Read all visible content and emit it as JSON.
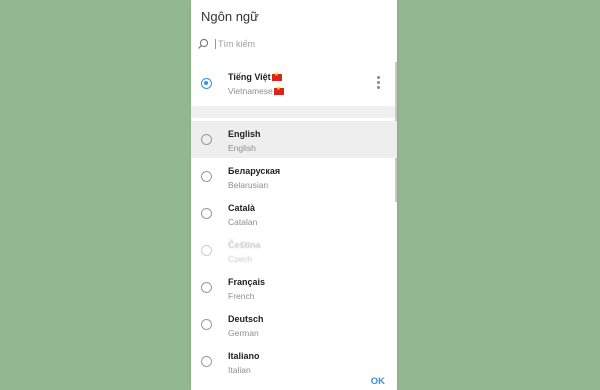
{
  "dialog": {
    "title": "Ngôn ngữ",
    "search_placeholder": "Tìm kiếm",
    "ok_label": "OK"
  },
  "current": {
    "name": "Tiếng Việt",
    "sub": "Vietnamese",
    "selected": true
  },
  "languages": [
    {
      "name": "English",
      "sub": "English"
    },
    {
      "name": "Беларуская",
      "sub": "Belarusian"
    },
    {
      "name": "Català",
      "sub": "Catalan"
    },
    {
      "name": "Čeština",
      "sub": "Czech"
    },
    {
      "name": "Français",
      "sub": "French"
    },
    {
      "name": "Deutsch",
      "sub": "German"
    },
    {
      "name": "Italiano",
      "sub": "Italian"
    }
  ],
  "colors": {
    "background": "#93b88f",
    "accent": "#3a8fd6"
  },
  "icons": [
    "search-icon",
    "more-vert-icon",
    "flag-vietnam-icon"
  ]
}
